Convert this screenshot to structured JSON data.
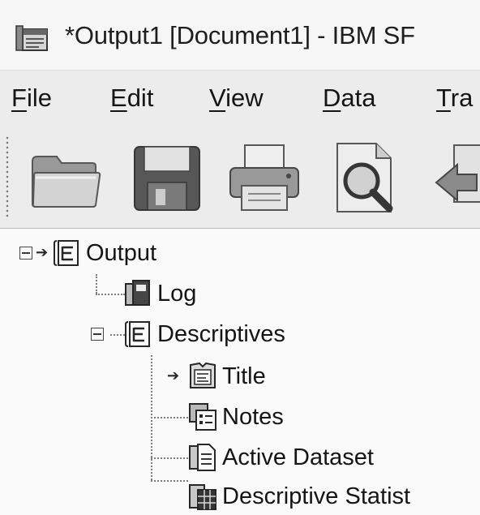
{
  "window": {
    "title": "*Output1 [Document1] - IBM SF"
  },
  "menu": {
    "items": [
      {
        "mnemonic": "F",
        "rest": "ile"
      },
      {
        "mnemonic": "E",
        "rest": "dit"
      },
      {
        "mnemonic": "V",
        "rest": "iew"
      },
      {
        "mnemonic": "D",
        "rest": "ata"
      },
      {
        "mnemonic": "T",
        "rest": "ra"
      }
    ]
  },
  "toolbar": {
    "buttons": [
      {
        "icon": "folder-open-icon"
      },
      {
        "icon": "floppy-save-icon"
      },
      {
        "icon": "printer-icon"
      },
      {
        "icon": "print-preview-icon"
      },
      {
        "icon": "export-icon"
      }
    ]
  },
  "tree": {
    "output": "Output",
    "log": "Log",
    "descriptives": "Descriptives",
    "title": "Title",
    "notes": "Notes",
    "active_dataset": "Active Dataset",
    "descriptive_statistics": "Descriptive Statist"
  },
  "colors": {
    "menubar": "#f0f0f0",
    "toolbar": "#f0f0f0",
    "tree_bg": "#ffffff",
    "text": "#111111"
  }
}
